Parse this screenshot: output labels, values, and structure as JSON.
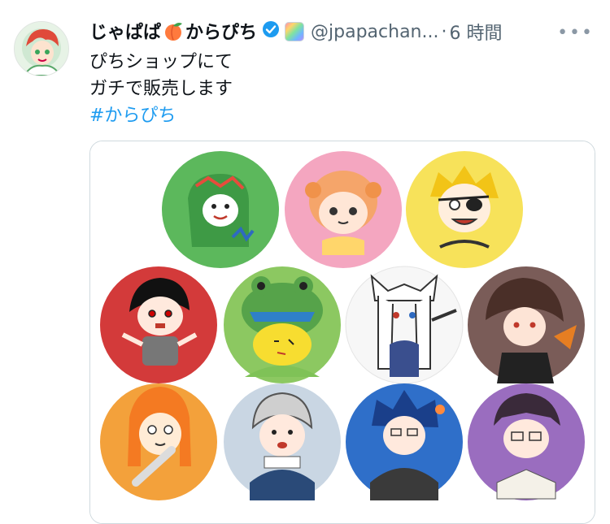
{
  "tweet": {
    "display_name_part1": "じゃぱぱ",
    "display_name_part2": "からぴち",
    "handle": "@jpapachan...",
    "separator": "·",
    "time": "6 時間",
    "more_label": "•••",
    "text_line1": "ぴちショップにて",
    "text_line2": "ガチで販売します",
    "hashtag": "#からぴち"
  },
  "icons": [
    "avatar",
    "peach-emoji-icon",
    "verified-badge-icon",
    "affiliate-badge-icon",
    "more-options-icon"
  ],
  "colors": {
    "link": "#1d9bf0",
    "verified": "#1d9bf0",
    "secondary_text": "#536471",
    "badge_green": "#5cb85c",
    "badge_pink": "#f4a6c0",
    "badge_yellow": "#f7e25a",
    "badge_red": "#d33a3a",
    "badge_lightgreen": "#8cc861",
    "badge_white": "#f7f7f7",
    "badge_brown": "#7a5c58",
    "badge_orange": "#f3a13b",
    "badge_lightblue": "#c9d6e3",
    "badge_blue": "#2f6fc9",
    "badge_purple": "#9a6dbf"
  }
}
